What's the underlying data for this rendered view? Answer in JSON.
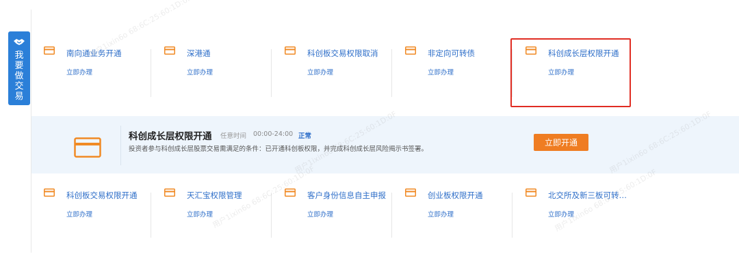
{
  "side_tab": {
    "label": "我要做交易"
  },
  "top_row": [
    {
      "title": "南向通业务开通",
      "action": "立即办理"
    },
    {
      "title": "深港通",
      "action": "立即办理"
    },
    {
      "title": "科创板交易权限取消",
      "action": "立即办理"
    },
    {
      "title": "非定向可转债",
      "action": "立即办理"
    },
    {
      "title": "科创成长层权限开通",
      "action": "立即办理"
    }
  ],
  "banner": {
    "title": "科创成长层权限开通",
    "time_label": "任意时间",
    "time": "00:00-24:00",
    "status": "正常",
    "description": "投资者参与科创成长层股票交易需满足的条件：已开通科创板权限，并完成科创成长层风险揭示书签署。",
    "button_label": "立即开通"
  },
  "bottom_row": [
    {
      "title": "科创板交易权限开通",
      "action": "立即办理"
    },
    {
      "title": "天汇宝权限管理",
      "action": "立即办理"
    },
    {
      "title": "客户身份信息自主申报",
      "action": "立即办理"
    },
    {
      "title": "创业板权限开通",
      "action": "立即办理"
    },
    {
      "title": "北交所及新三板可转…",
      "action": "立即办理"
    }
  ],
  "watermark": "用户1ixin6o 68:6C:25:60:1D:0F",
  "colors": {
    "accent_blue": "#2f6fc9",
    "side_tab_blue": "#2b7fd8",
    "card_icon_orange": "#f08a24",
    "button_orange": "#ef7d22",
    "highlight_red": "#e02c22",
    "banner_bg": "#eef5fc"
  }
}
